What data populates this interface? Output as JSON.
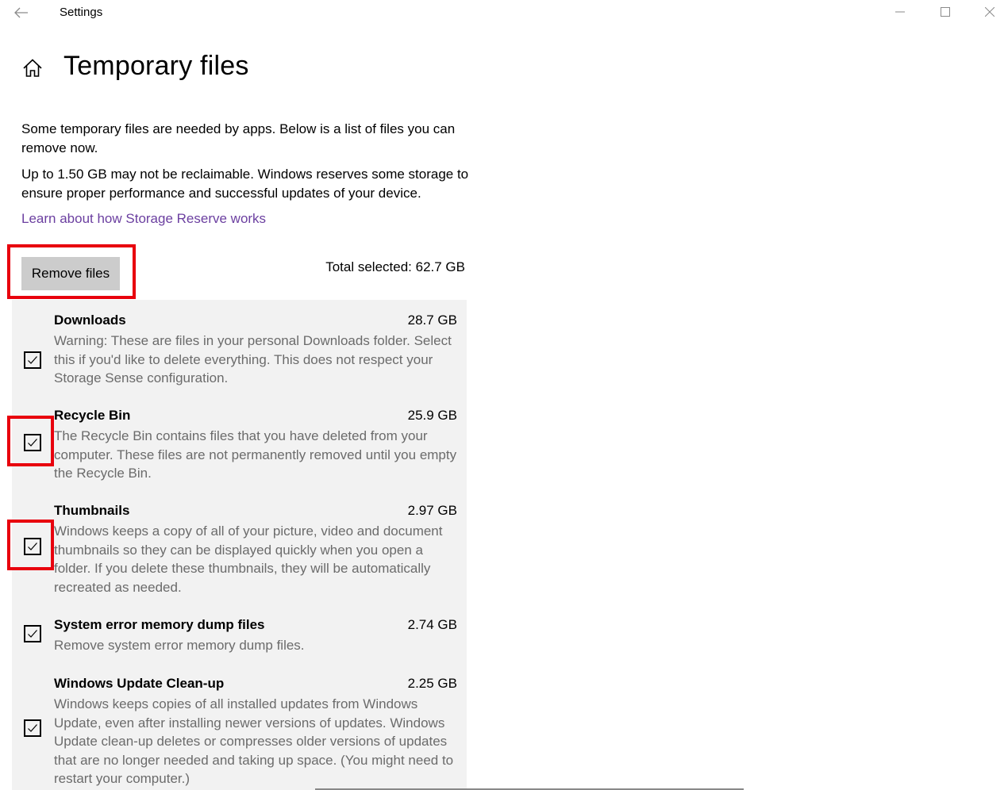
{
  "window": {
    "title": "Settings"
  },
  "header": {
    "title": "Temporary files"
  },
  "description": {
    "para1": "Some temporary files are needed by apps. Below is a list of files you can remove now.",
    "para2": "Up to 1.50 GB may not be reclaimable. Windows reserves some storage to ensure proper performance and successful updates of your device.",
    "link": "Learn about how Storage Reserve works"
  },
  "actions": {
    "remove_label": "Remove files",
    "total_selected": "Total selected: 62.7 GB"
  },
  "colors": {
    "link": "#6b3fa0",
    "annotation": "#e8000d",
    "list_background": "#f2f2f2",
    "button_background": "#cccccc"
  },
  "files": [
    {
      "name": "Downloads",
      "size": "28.7 GB",
      "description": "Warning: These are files in your personal Downloads folder. Select this if you'd like to delete everything. This does not respect your Storage Sense configuration.",
      "checked": true
    },
    {
      "name": "Recycle Bin",
      "size": "25.9 GB",
      "description": "The Recycle Bin contains files that you have deleted from your computer. These files are not permanently removed until you empty the Recycle Bin.",
      "checked": true
    },
    {
      "name": "Thumbnails",
      "size": "2.97 GB",
      "description": "Windows keeps a copy of all of your picture, video and document thumbnails so they can be displayed quickly when you open a folder. If you delete these thumbnails, they will be automatically recreated as needed.",
      "checked": true
    },
    {
      "name": "System error memory dump files",
      "size": "2.74 GB",
      "description": "Remove system error memory dump files.",
      "checked": true
    },
    {
      "name": "Windows Update Clean-up",
      "size": "2.25 GB",
      "description": "Windows keeps copies of all installed updates from Windows Update, even after installing newer versions of updates. Windows Update clean-up deletes or compresses older versions of updates that are no longer needed and taking up space. (You might need to restart your computer.)",
      "checked": true
    }
  ]
}
